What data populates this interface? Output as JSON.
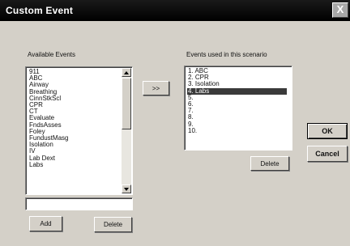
{
  "window": {
    "title": "Custom Event",
    "close_glyph": "X"
  },
  "available": {
    "label": "Available Events",
    "items": [
      "911",
      "ABC",
      "Airway",
      "Breathing",
      "CinnStkScl",
      "CPR",
      "CT",
      "Evaluate",
      "FndsAsses",
      "Foley",
      "FundustMasg",
      "Isolation",
      "IV",
      "Lab Dext",
      "Labs"
    ],
    "input_value": "",
    "add_label": "Add",
    "delete_label": "Delete"
  },
  "transfer": {
    "label": ">>"
  },
  "scenario": {
    "label": "Events used in this scenario",
    "items": [
      "1. ABC",
      "2. CPR",
      "3. Isolation",
      "4. Labs",
      "5.",
      "6.",
      "7.",
      "8.",
      "9.",
      "10."
    ],
    "selected_index": 3,
    "delete_label": "Delete"
  },
  "dialog": {
    "ok_label": "OK",
    "cancel_label": "Cancel"
  }
}
